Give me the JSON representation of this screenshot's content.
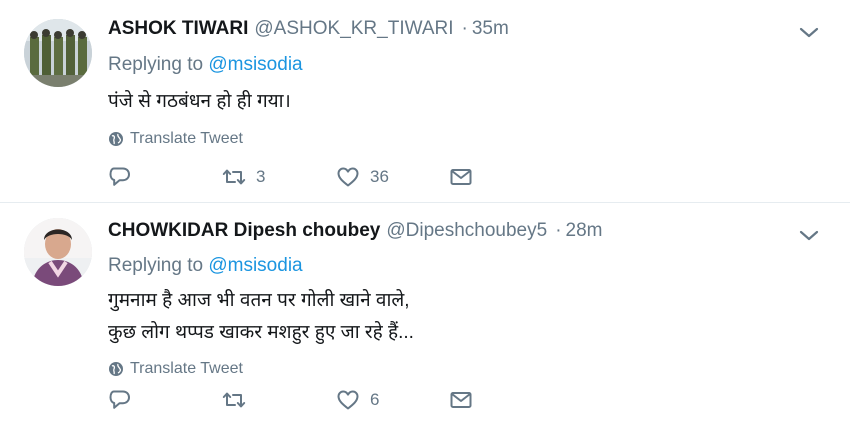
{
  "tweets": [
    {
      "name": "ASHOK TIWARI",
      "handle": "@ASHOK_KR_TIWARI",
      "time": "35m",
      "replying_label": "Replying to",
      "replying_handle": "@msisodia",
      "lines": [
        "पंजे से गठबंधन हो ही गया।"
      ],
      "translate": "Translate Tweet",
      "retweets": "3",
      "likes": "36"
    },
    {
      "name": "CHOWKIDAR Dipesh choubey",
      "handle": "@Dipeshchoubey5",
      "time": "28m",
      "replying_label": "Replying to",
      "replying_handle": "@msisodia",
      "lines": [
        "गुमनाम है आज भी वतन पर गोली खाने वाले,",
        "कुछ लोग थप्पड खाकर मशहुर हुए जा रहे हैं..."
      ],
      "translate": "Translate Tweet",
      "retweets": "",
      "likes": "6"
    }
  ],
  "separator": "·",
  "icons": {
    "caret": "chevron-down-icon",
    "globe": "globe-icon",
    "reply": "reply-icon",
    "retweet": "retweet-icon",
    "like": "heart-icon",
    "message": "envelope-icon"
  },
  "colors": {
    "link": "#1b95e0",
    "muted": "#657786",
    "text": "#14171a",
    "border": "#e6ecf0"
  }
}
